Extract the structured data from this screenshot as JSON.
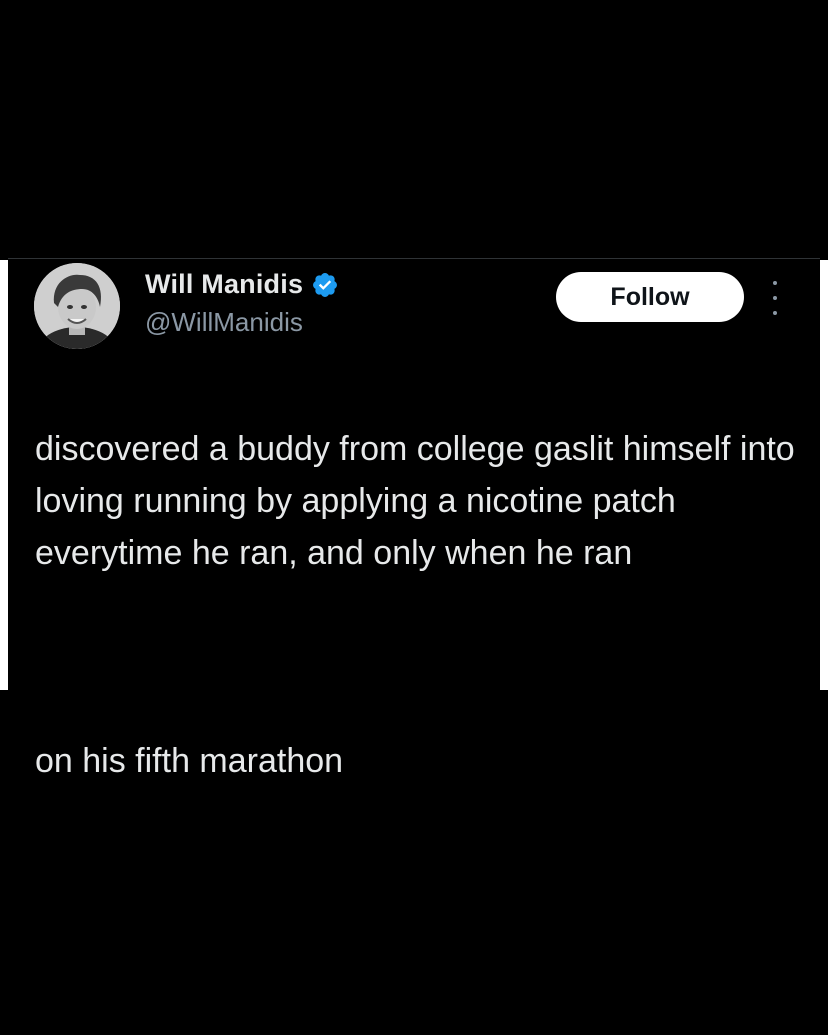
{
  "tweet": {
    "author": {
      "display_name": "Will Manidis",
      "handle": "@WillManidis",
      "verified": true,
      "avatar_icon": "avatar-photo"
    },
    "follow_label": "Follow",
    "more_icon": "ellipsis-vertical-icon",
    "paragraphs": [
      "discovered a buddy from college gaslit himself into loving running by applying a nicotine patch everytime he ran, and only when he ran",
      "on his fifth marathon"
    ]
  },
  "colors": {
    "background": "#000000",
    "text": "#e7e9ea",
    "secondary_text": "#8b98a5",
    "verified_badge": "#1d9bf0",
    "follow_button_bg": "#ffffff",
    "follow_button_text": "#0f1419"
  }
}
